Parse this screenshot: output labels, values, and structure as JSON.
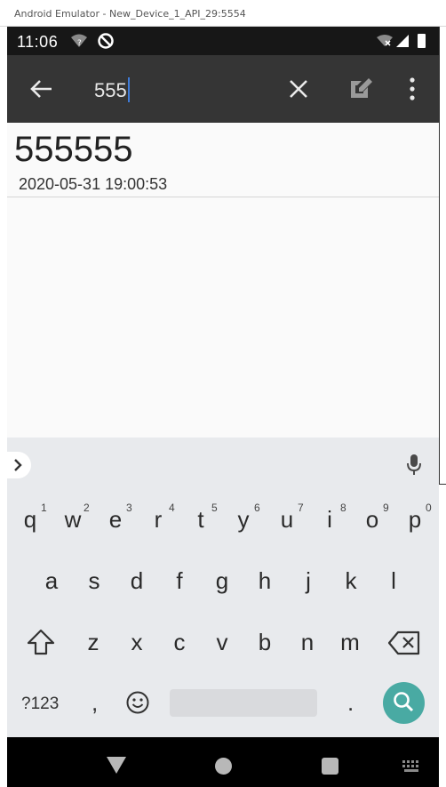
{
  "window": {
    "title": "Android Emulator - New_Device_1_API_29:5554"
  },
  "status_bar": {
    "time": "11:06",
    "icons_left": [
      "wifi-question-icon",
      "data-saver-icon"
    ],
    "icons_right": [
      "wifi-x-icon",
      "signal-icon",
      "battery-icon"
    ]
  },
  "toolbar": {
    "search_value": "555",
    "icons": [
      "back-arrow-icon",
      "clear-icon",
      "edit-icon",
      "more-vert-icon"
    ]
  },
  "results": [
    {
      "title": "555555",
      "date": "2020-05-31 19:00:53"
    }
  ],
  "keyboard": {
    "row1": [
      {
        "k": "q",
        "n": "1"
      },
      {
        "k": "w",
        "n": "2"
      },
      {
        "k": "e",
        "n": "3"
      },
      {
        "k": "r",
        "n": "4"
      },
      {
        "k": "t",
        "n": "5"
      },
      {
        "k": "y",
        "n": "6"
      },
      {
        "k": "u",
        "n": "7"
      },
      {
        "k": "i",
        "n": "8"
      },
      {
        "k": "o",
        "n": "9"
      },
      {
        "k": "p",
        "n": "0"
      }
    ],
    "row2": [
      "a",
      "s",
      "d",
      "f",
      "g",
      "h",
      "j",
      "k",
      "l"
    ],
    "row3": [
      "z",
      "x",
      "c",
      "v",
      "b",
      "n",
      "m"
    ],
    "symbols_label": "?123",
    "comma": ",",
    "period": ".",
    "accent_color": "#49aaa3"
  },
  "colors": {
    "toolbar": "#353535",
    "status_bar": "#171717",
    "cursor": "#3f7bd9"
  }
}
